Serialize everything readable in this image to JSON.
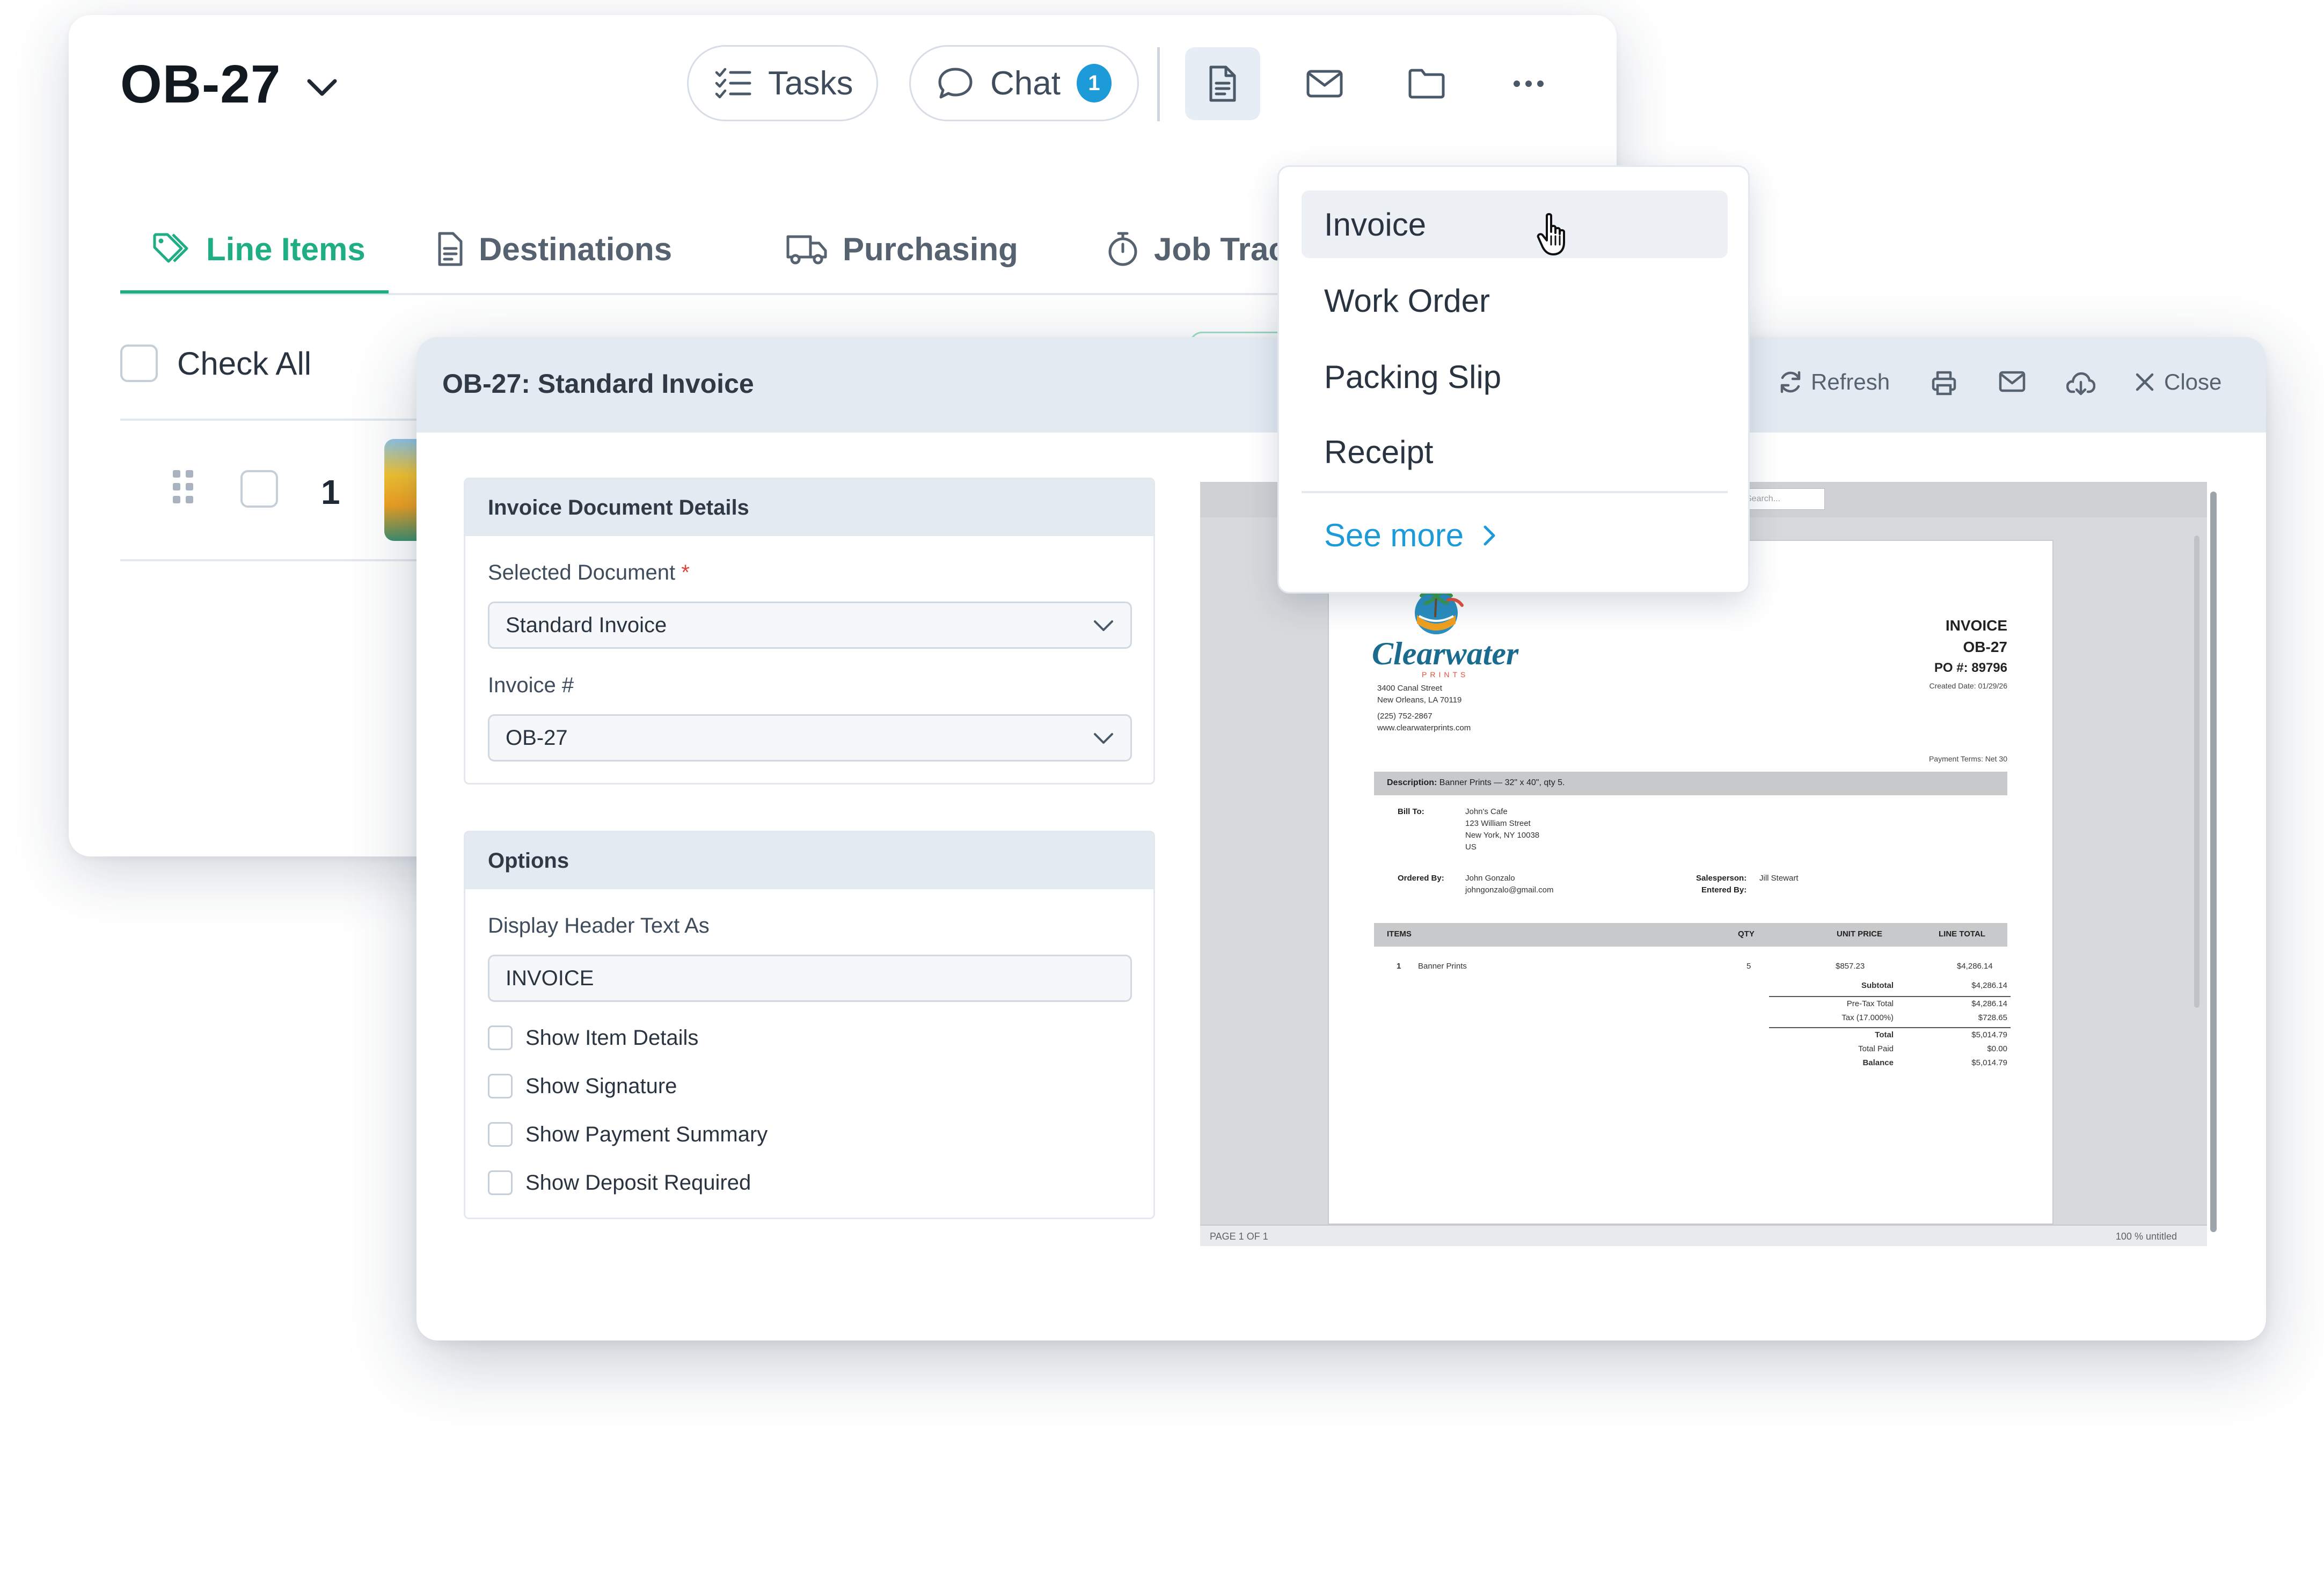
{
  "header": {
    "order_title": "OB-27",
    "tasks_label": "Tasks",
    "chat_label": "Chat",
    "chat_badge": "1"
  },
  "tabs": [
    {
      "label": "Line Items",
      "icon": "tag-icon",
      "active": true
    },
    {
      "label": "Destinations",
      "icon": "document-icon",
      "active": false
    },
    {
      "label": "Purchasing",
      "icon": "truck-icon",
      "active": false
    },
    {
      "label": "Job Tracking",
      "icon": "stopwatch-icon",
      "active": false
    }
  ],
  "line_items": {
    "check_all_label": "Check All",
    "rows": [
      {
        "number": "1"
      }
    ]
  },
  "document_menu": {
    "items": [
      "Invoice",
      "Work Order",
      "Packing Slip",
      "Receipt"
    ],
    "hovered": "Invoice",
    "see_more_label": "See more"
  },
  "modal": {
    "title": "OB-27: Standard Invoice",
    "actions": {
      "refresh": "Refresh",
      "close": "Close"
    },
    "details_panel": {
      "heading": "Invoice Document Details",
      "selected_document_label": "Selected Document",
      "required_marker": "*",
      "selected_document_value": "Standard Invoice",
      "invoice_number_label": "Invoice #",
      "invoice_number_value": "OB-27"
    },
    "options_panel": {
      "heading": "Options",
      "header_text_label": "Display Header Text As",
      "header_text_value": "INVOICE",
      "checkboxes": [
        {
          "label": "Show Item Details",
          "checked": false
        },
        {
          "label": "Show Signature",
          "checked": false
        },
        {
          "label": "Show Payment Summary",
          "checked": false
        },
        {
          "label": "Show Deposit Required",
          "checked": false
        }
      ]
    }
  },
  "pdf_viewer": {
    "search_placeholder": "Search...",
    "page_status": "PAGE 1 OF 1",
    "zoom_status": "100 %  untitled"
  },
  "invoice_doc": {
    "brand": "Clearwater",
    "brand_sub": "PRINTS",
    "address_lines": [
      "3400 Canal Street",
      "New Orleans, LA 70119"
    ],
    "phone": "(225) 752-2867",
    "website": "www.clearwaterprints.com",
    "title": "INVOICE",
    "number": "OB-27",
    "po": "PO #: 89796",
    "created": "Created Date: 01/29/26",
    "payment_terms": "Payment Terms: Net 30",
    "description_label": "Description:",
    "description": "Banner Prints — 32\" x 40\", qty 5.",
    "bill_to_label": "Bill To:",
    "bill_to_lines": [
      "John's Cafe",
      "123 William Street",
      "New York, NY 10038",
      "US"
    ],
    "ordered_by_label": "Ordered By:",
    "ordered_by_lines": [
      "John Gonzalo",
      "johngonzalo@gmail.com"
    ],
    "salesperson_label": "Salesperson:",
    "salesperson": "Jill Stewart",
    "entered_by_label": "Entered By:",
    "columns": {
      "items": "ITEMS",
      "qty": "QTY",
      "unit_price": "UNIT PRICE",
      "line_total": "LINE TOTAL"
    },
    "items": [
      {
        "index": "1",
        "name": "Banner Prints",
        "qty": "5",
        "unit_price": "$857.23",
        "line_total": "$4,286.14"
      }
    ],
    "totals": {
      "subtotal_label": "Subtotal",
      "subtotal": "$4,286.14",
      "pretax_label": "Pre-Tax Total",
      "pretax": "$4,286.14",
      "tax_label": "Tax (17.000%)",
      "tax": "$728.65",
      "total_label": "Total",
      "total": "$5,014.79",
      "paid_label": "Total Paid",
      "paid": "$0.00",
      "balance_label": "Balance",
      "balance": "$5,014.79"
    }
  },
  "colors": {
    "accent_green": "#1fae84",
    "link_blue": "#1d9bd8",
    "panel_header": "#e4eaf2",
    "required_red": "#e0443a"
  }
}
